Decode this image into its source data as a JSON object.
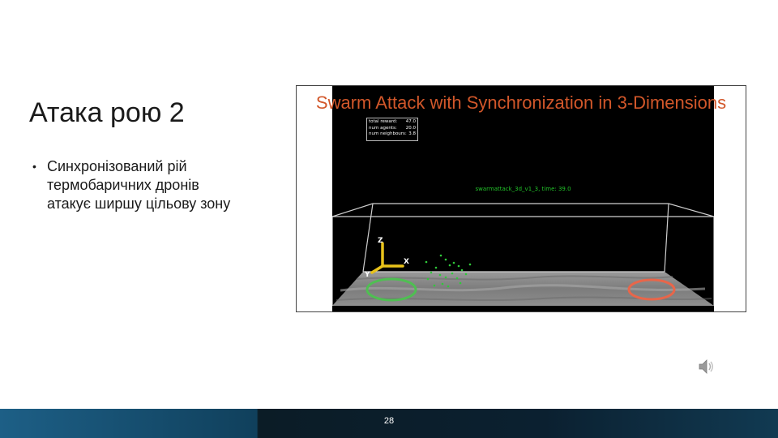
{
  "slide": {
    "title": "Атака рою 2",
    "bullets": [
      "Синхронізований рій термобаричних дронів атакує ширшу цільову зону"
    ],
    "page_number": "28"
  },
  "video": {
    "title": "Swarm Attack with Synchronization in 3-Dimensions",
    "title_color": "#d2572a",
    "stats": [
      {
        "label": "total reward:",
        "value": "47.0"
      },
      {
        "label": "num agents:",
        "value": "20.0"
      },
      {
        "label": "num neighbours:",
        "value": "3.8"
      }
    ],
    "caption": "swarmattack_3d_v1_3, time: 39.0",
    "caption_color": "#22c42a",
    "axes": {
      "z": "Z",
      "x": "X",
      "y": "Y"
    },
    "start_ring_color": "#4fbf52",
    "target_ring_color": "#e8664a"
  },
  "icons": {
    "speaker": "speaker-icon"
  }
}
